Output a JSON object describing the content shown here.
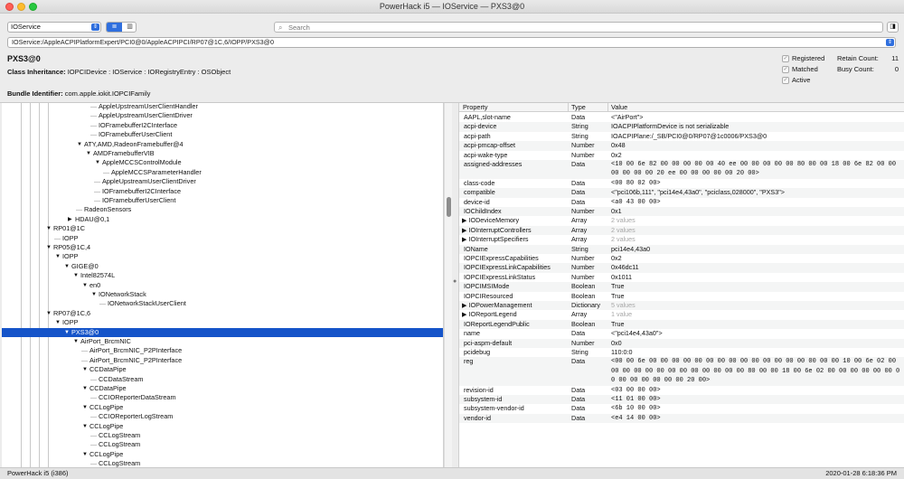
{
  "window": {
    "title": "PowerHack i5 — IOService — PXS3@0"
  },
  "toolbar": {
    "plane": "IOService",
    "search_placeholder": "Search"
  },
  "path": "IOService:/AppleACPIPlatformExpert/PCI0@0/AppleACPIPCI/RP07@1C,6/IOPP/PXS3@0",
  "info": {
    "name": "PXS3@0",
    "class_label": "Class Inheritance:",
    "class_value": "IOPCIDevice : IOService : IORegistryEntry : OSObject",
    "bundle_label": "Bundle Identifier:",
    "bundle_value": "com.apple.iokit.IOPCIFamily",
    "registered": "Registered",
    "matched": "Matched",
    "active": "Active",
    "retain_label": "Retain Count:",
    "retain_value": "11",
    "busy_label": "Busy Count:",
    "busy_value": "0"
  },
  "tree": [
    {
      "label": "AppleUpstreamUserClientHandler",
      "indent": 107,
      "arrow": ""
    },
    {
      "label": "AppleUpstreamUserClientDriver",
      "indent": 107,
      "arrow": ""
    },
    {
      "label": "IOFramebufferI2CInterface",
      "indent": 107,
      "arrow": ""
    },
    {
      "label": "IOFramebufferUserClient",
      "indent": 107,
      "arrow": ""
    },
    {
      "label": "ATY,AMD,RadeonFramebuffer@4",
      "indent": 91,
      "arrow": "▼"
    },
    {
      "label": "AMDFramebufferVIB",
      "indent": 101,
      "arrow": "▼"
    },
    {
      "label": "AppleMCCSControlModule",
      "indent": 111,
      "arrow": "▼"
    },
    {
      "label": "AppleMCCSParameterHandler",
      "indent": 121,
      "arrow": ""
    },
    {
      "label": "AppleUpstreamUserClientDriver",
      "indent": 111,
      "arrow": ""
    },
    {
      "label": "IOFramebufferI2CInterface",
      "indent": 111,
      "arrow": ""
    },
    {
      "label": "IOFramebufferUserClient",
      "indent": 111,
      "arrow": ""
    },
    {
      "label": "RadeonSensors",
      "indent": 91,
      "arrow": ""
    },
    {
      "label": "HDAU@0,1",
      "indent": 81,
      "arrow": "▶"
    },
    {
      "label": "RP01@1C",
      "indent": 57,
      "arrow": "▼"
    },
    {
      "label": "IOPP",
      "indent": 67,
      "arrow": ""
    },
    {
      "label": "RP05@1C,4",
      "indent": 57,
      "arrow": "▼"
    },
    {
      "label": "IOPP",
      "indent": 67,
      "arrow": "▼"
    },
    {
      "label": "GIGE@0",
      "indent": 77,
      "arrow": "▼"
    },
    {
      "label": "Intel82574L",
      "indent": 87,
      "arrow": "▼"
    },
    {
      "label": "en0",
      "indent": 97,
      "arrow": "▼"
    },
    {
      "label": "IONetworkStack",
      "indent": 107,
      "arrow": "▼"
    },
    {
      "label": "IONetworkStackUserClient",
      "indent": 117,
      "arrow": ""
    },
    {
      "label": "RP07@1C,6",
      "indent": 57,
      "arrow": "▼"
    },
    {
      "label": "IOPP",
      "indent": 67,
      "arrow": "▼"
    },
    {
      "label": "PXS3@0",
      "indent": 77,
      "arrow": "▼",
      "selected": true
    },
    {
      "label": "AirPort_BrcmNIC",
      "indent": 87,
      "arrow": "▼"
    },
    {
      "label": "AirPort_BrcmNIC_P2PInterface",
      "indent": 97,
      "arrow": ""
    },
    {
      "label": "AirPort_BrcmNIC_P2PInterface",
      "indent": 97,
      "arrow": ""
    },
    {
      "label": "CCDataPipe",
      "indent": 97,
      "arrow": "▼"
    },
    {
      "label": "CCDataStream",
      "indent": 107,
      "arrow": ""
    },
    {
      "label": "CCDataPipe",
      "indent": 97,
      "arrow": "▼"
    },
    {
      "label": "CCIOReporterDataStream",
      "indent": 107,
      "arrow": ""
    },
    {
      "label": "CCLogPipe",
      "indent": 97,
      "arrow": "▼"
    },
    {
      "label": "CCIOReporterLogStream",
      "indent": 107,
      "arrow": ""
    },
    {
      "label": "CCLogPipe",
      "indent": 97,
      "arrow": "▼"
    },
    {
      "label": "CCLogStream",
      "indent": 107,
      "arrow": ""
    },
    {
      "label": "CCLogStream",
      "indent": 107,
      "arrow": ""
    },
    {
      "label": "CCLogPipe",
      "indent": 97,
      "arrow": "▼"
    },
    {
      "label": "CCLogStream",
      "indent": 107,
      "arrow": ""
    }
  ],
  "props_header": {
    "property": "Property",
    "type": "Type",
    "value": "Value"
  },
  "props": [
    {
      "k": "AAPL,slot-name",
      "t": "Data",
      "v": "<\"AirPort\">",
      "lines": 1
    },
    {
      "k": "acpi-device",
      "t": "String",
      "v": "IOACPIPlatformDevice is not serializable",
      "lines": 1
    },
    {
      "k": "acpi-path",
      "t": "String",
      "v": "IOACPIPlane:/_SB/PCI0@0/RP07@1c0006/PXS3@0",
      "lines": 1
    },
    {
      "k": "acpi-pmcap-offset",
      "t": "Number",
      "v": "0x48",
      "lines": 1
    },
    {
      "k": "acpi-wake-type",
      "t": "Number",
      "v": "0x2",
      "lines": 1
    },
    {
      "k": "assigned-addresses",
      "t": "Data",
      "v": "<10 00 6e 82 00 00 00 00 00 40 ee 00 00 00 00 00 80 00 00 18 00 6e 82 00 00 00 00 00 00 20 ee 00 00 00 00 00 20 00>",
      "lines": 2,
      "mono": true
    },
    {
      "k": "class-code",
      "t": "Data",
      "v": "<00 80 02 00>",
      "lines": 1,
      "mono": true
    },
    {
      "k": "compatible",
      "t": "Data",
      "v": "<\"pci106b,111\", \"pci14e4,43a0\", \"pciclass,028000\", \"PXS3\">",
      "lines": 1
    },
    {
      "k": "device-id",
      "t": "Data",
      "v": "<a0 43 00 00>",
      "lines": 1,
      "mono": true
    },
    {
      "k": "IOChildIndex",
      "t": "Number",
      "v": "0x1",
      "lines": 1
    },
    {
      "k": "IODeviceMemory",
      "t": "Array",
      "v": "2 values",
      "lines": 1,
      "exp": true,
      "gray": true
    },
    {
      "k": "IOInterruptControllers",
      "t": "Array",
      "v": "2 values",
      "lines": 1,
      "exp": true,
      "gray": true
    },
    {
      "k": "IOInterruptSpecifiers",
      "t": "Array",
      "v": "2 values",
      "lines": 1,
      "exp": true,
      "gray": true
    },
    {
      "k": "IOName",
      "t": "String",
      "v": "pci14e4,43a0",
      "lines": 1
    },
    {
      "k": "IOPCIExpressCapabilities",
      "t": "Number",
      "v": "0x2",
      "lines": 1
    },
    {
      "k": "IOPCIExpressLinkCapabilities",
      "t": "Number",
      "v": "0x46dc11",
      "lines": 1
    },
    {
      "k": "IOPCIExpressLinkStatus",
      "t": "Number",
      "v": "0x1011",
      "lines": 1
    },
    {
      "k": "IOPCIMSIMode",
      "t": "Boolean",
      "v": "True",
      "lines": 1
    },
    {
      "k": "IOPCIResourced",
      "t": "Boolean",
      "v": "True",
      "lines": 1
    },
    {
      "k": "IOPowerManagement",
      "t": "Dictionary",
      "v": "5 values",
      "lines": 1,
      "exp": true,
      "gray": true
    },
    {
      "k": "IOReportLegend",
      "t": "Array",
      "v": "1 value",
      "lines": 1,
      "exp": true,
      "gray": true
    },
    {
      "k": "IOReportLegendPublic",
      "t": "Boolean",
      "v": "True",
      "lines": 1
    },
    {
      "k": "name",
      "t": "Data",
      "v": "<\"pci14e4,43a0\">",
      "lines": 1
    },
    {
      "k": "pci-aspm-default",
      "t": "Number",
      "v": "0x0",
      "lines": 1
    },
    {
      "k": "pcidebug",
      "t": "String",
      "v": "110:0:0",
      "lines": 1
    },
    {
      "k": "reg",
      "t": "Data",
      "v": "<00 00 6e 00 00 00 00 00 00 00 00 00 00 00 00 00 00 00 00 00 10 00 6e 02 00 00 00 00 00 00 00 00 00 00 00 00 00 80 00 00 18 00 6e 02 00 00 00 00 00 00 00 00 00 00 00 00 00 20 00>",
      "lines": 3,
      "mono": true
    },
    {
      "k": "revision-id",
      "t": "Data",
      "v": "<03 00 00 00>",
      "lines": 1,
      "mono": true
    },
    {
      "k": "subsystem-id",
      "t": "Data",
      "v": "<11 01 00 00>",
      "lines": 1,
      "mono": true
    },
    {
      "k": "subsystem-vendor-id",
      "t": "Data",
      "v": "<6b 10 00 00>",
      "lines": 1,
      "mono": true
    },
    {
      "k": "vendor-id",
      "t": "Data",
      "v": "<e4 14 00 00>",
      "lines": 1,
      "mono": true
    }
  ],
  "status": {
    "left": "PowerHack i5 (i386)",
    "right": "2020-01-28  6:18:36 PM"
  }
}
